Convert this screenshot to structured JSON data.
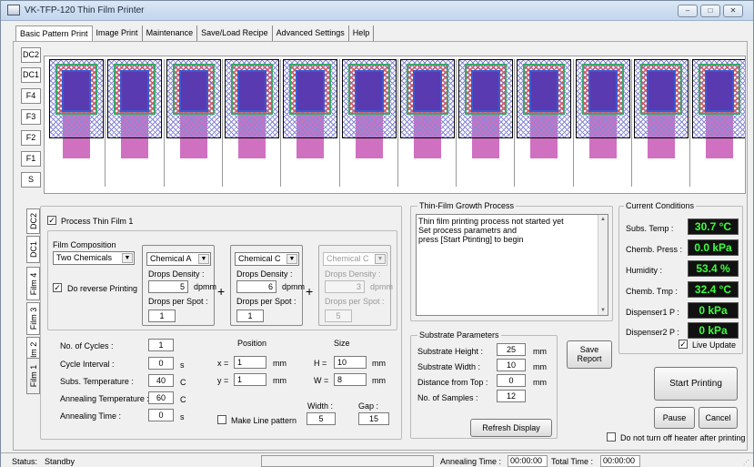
{
  "window": {
    "title": "VK-TFP-120 Thin Film Printer",
    "min_label": "▭",
    "max_label": "▢",
    "close_label": "✕"
  },
  "tabs": [
    "Basic Pattern Print",
    "Image Print",
    "Maintenance",
    "Save/Load Recipe",
    "Advanced Settings",
    "Help"
  ],
  "side_tabs": [
    "DC2",
    "DC1",
    "F4",
    "F3",
    "F2",
    "F1",
    "S"
  ],
  "film_tabs": [
    "DC2",
    "DC1",
    "Film 4",
    "Film 3",
    "Film 2",
    "Film 1"
  ],
  "process": {
    "checkbox_label": "Process Thin Film 1",
    "checked": true
  },
  "composition": {
    "group_label": "Film Composition",
    "selected": "Two Chemicals",
    "reverse_label": "Do reverse Printing",
    "chem1": {
      "name": "Chemical A",
      "density_label": "Drops Density :",
      "density": "5",
      "unit": "dpmm",
      "spot_label": "Drops per Spot :",
      "spot": "1"
    },
    "chem2": {
      "name": "Chemical C",
      "density_label": "Drops Density :",
      "density": "6",
      "unit": "dpmm",
      "spot_label": "Drops per Spot :",
      "spot": "1"
    },
    "chem3": {
      "name": "Chemical C",
      "density_label": "Drops Density :",
      "density": "3",
      "unit": "dpmm",
      "spot_label": "Drops per Spot :",
      "spot": "5"
    },
    "plus": "+"
  },
  "params": {
    "cycles_label": "No. of Cycles :",
    "cycles": "1",
    "interval_label": "Cycle Interval :",
    "interval": "0",
    "interval_unit": "s",
    "subs_temp_label": "Subs. Temperature :",
    "subs_temp": "40",
    "subs_temp_unit": "C",
    "anneal_temp_label": "Annealing Temperature :",
    "anneal_temp": "60",
    "anneal_temp_unit": "C",
    "anneal_time_label": "Annealing Time :",
    "anneal_time": "0",
    "anneal_time_unit": "s"
  },
  "position": {
    "title": "Position",
    "x_label": "x =",
    "x": "1",
    "y_label": "y =",
    "y": "1",
    "unit": "mm"
  },
  "size": {
    "title": "Size",
    "h_label": "H =",
    "h": "10",
    "w_label": "W =",
    "w": "8",
    "unit": "mm"
  },
  "line": {
    "checkbox_label": "Make Line pattern",
    "width_label": "Width :",
    "width": "5",
    "gap_label": "Gap :",
    "gap": "15"
  },
  "growth": {
    "title": "Thin-Film Growth Process",
    "lines": [
      "Thin film printing process not started yet",
      "Set process parametrs and",
      "press [Start Ptinting] to begin"
    ]
  },
  "substrate": {
    "title": "Substrate Parameters",
    "height_label": "Substrate Height :",
    "height": "25",
    "width_label": "Substrate Width :",
    "width": "10",
    "distance_label": "Distance from Top :",
    "distance": "0",
    "samples_label": "No. of Samples :",
    "samples": "12",
    "unit": "mm",
    "refresh": "Refresh Display"
  },
  "save_report": "Save\nReport",
  "conditions": {
    "title": "Current Conditions",
    "rows": [
      {
        "label": "Subs. Temp :",
        "value": "30.7 °C"
      },
      {
        "label": "Chemb. Press :",
        "value": "0.0 kPa"
      },
      {
        "label": "Humidity :",
        "value": "53.4 %"
      },
      {
        "label": "Chemb. Tmp :",
        "value": "32.4 °C"
      },
      {
        "label": "Dispenser1 P :",
        "value": "0 kPa"
      },
      {
        "label": "Dispenser2 P :",
        "value": "0 kPa"
      }
    ],
    "live_update": "Live Update"
  },
  "actions": {
    "start": "Start Printing",
    "pause": "Pause",
    "cancel": "Cancel",
    "heater_label": "Do not turn off heater after printing"
  },
  "status": {
    "label": "Status:",
    "value": "Standby",
    "anneal_label": "Annealing Time :",
    "anneal_value": "00:00:00",
    "total_label": "Total Time :",
    "total_value": "00:00:00"
  },
  "pattern_count": 12
}
